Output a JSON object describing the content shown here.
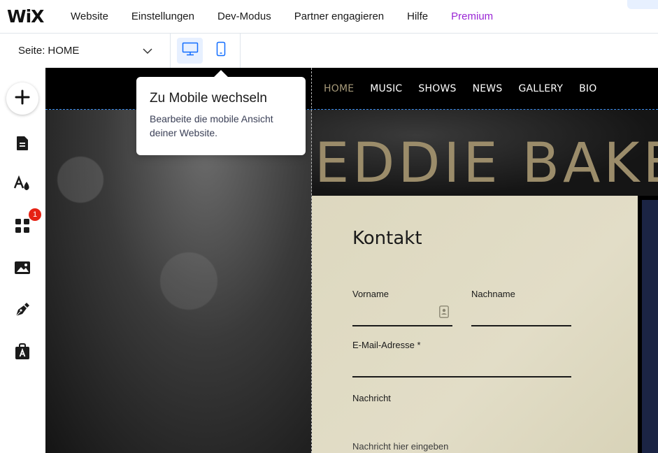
{
  "app": {
    "logo": "WiX",
    "menu": [
      "Website",
      "Einstellungen",
      "Dev-Modus",
      "Partner engagieren",
      "Hilfe"
    ],
    "premium": "Premium"
  },
  "pagebar": {
    "page_label": "Seite:",
    "page_value": "HOME"
  },
  "leftbar": {
    "tools": [
      "add-icon",
      "pages-icon",
      "design-icon",
      "apps-icon",
      "media-icon",
      "blog-icon",
      "portfolio-icon"
    ],
    "apps_badge": "1"
  },
  "tooltip": {
    "title": "Zu Mobile wechseln",
    "body": "Bearbeite die mobile Ansicht deiner Website."
  },
  "site": {
    "nav": [
      "HOME",
      "MUSIC",
      "SHOWS",
      "NEWS",
      "GALLERY",
      "BIO"
    ],
    "active_nav": "HOME",
    "title": "EDDIE BAKE",
    "contact": {
      "heading": "Kontakt",
      "first_name_label": "Vorname",
      "last_name_label": "Nachname",
      "email_label": "E-Mail-Adresse *",
      "message_label": "Nachricht",
      "message_placeholder": "Nachricht hier eingeben"
    }
  },
  "colors": {
    "premium": "#9a27d5",
    "accent_blue": "#116dff",
    "nav_active": "#a79a7a",
    "title_gold": "#9b8c6a",
    "contact_bg": "#ddd8bf",
    "badge_red": "#e62214"
  }
}
